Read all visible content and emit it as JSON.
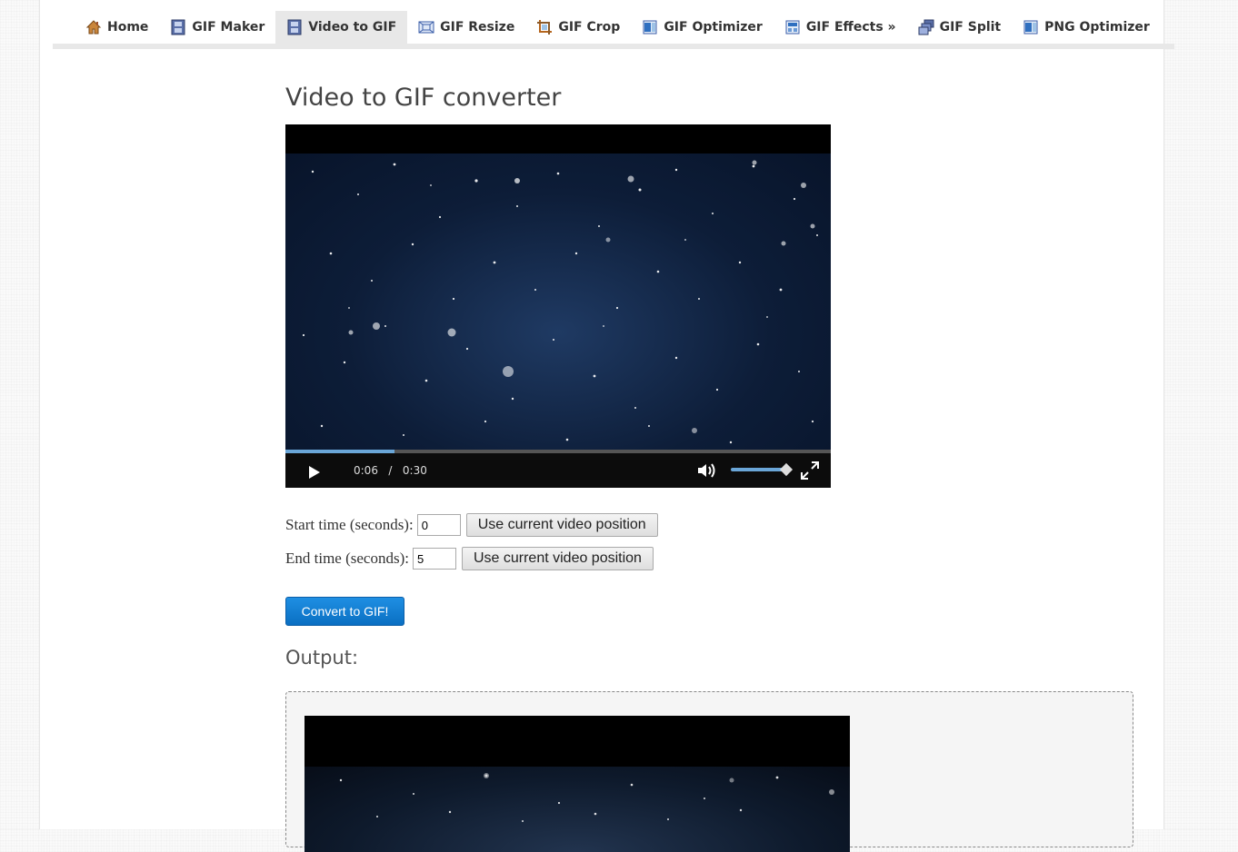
{
  "nav": {
    "items": [
      {
        "label": "Home",
        "icon": "home-icon",
        "active": false
      },
      {
        "label": "GIF Maker",
        "icon": "film-icon",
        "active": false
      },
      {
        "label": "Video to GIF",
        "icon": "film-icon",
        "active": true
      },
      {
        "label": "GIF Resize",
        "icon": "resize-icon",
        "active": false
      },
      {
        "label": "GIF Crop",
        "icon": "crop-icon",
        "active": false
      },
      {
        "label": "GIF Optimizer",
        "icon": "optimize-icon",
        "active": false
      },
      {
        "label": "GIF Effects »",
        "icon": "effects-icon",
        "active": false
      },
      {
        "label": "GIF Split",
        "icon": "split-icon",
        "active": false
      },
      {
        "label": "PNG Optimizer",
        "icon": "optimize-icon",
        "active": false
      }
    ]
  },
  "page": {
    "title": "Video to GIF converter"
  },
  "video": {
    "current_time": "0:06",
    "separator": "/",
    "duration": "0:30",
    "progress_fraction": 0.2,
    "volume_fraction": 0.95
  },
  "form": {
    "start_label": "Start time (seconds):",
    "start_value": "0",
    "end_label": "End time (seconds):",
    "end_value": "5",
    "use_position_label": "Use current video position",
    "convert_label": "Convert to GIF!"
  },
  "output": {
    "title": "Output:"
  },
  "colors": {
    "accent": "#0a6fc2",
    "active_tab": "#e8e8e8"
  }
}
